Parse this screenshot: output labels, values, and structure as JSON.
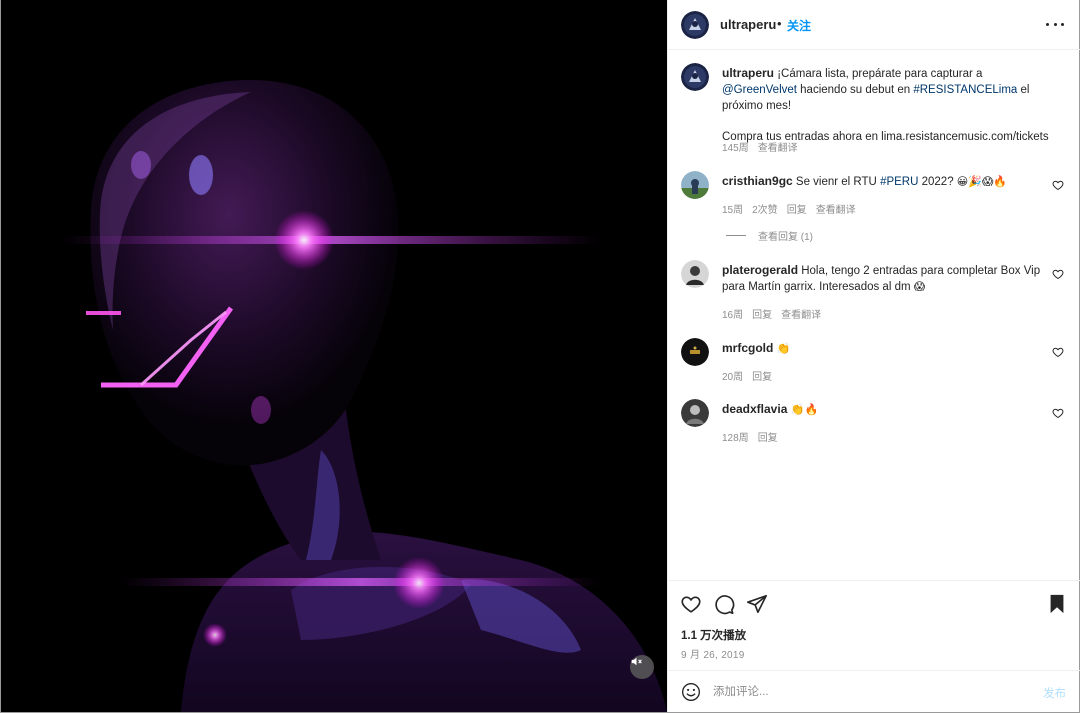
{
  "post": {
    "username": "ultraperu",
    "separator": "•",
    "follow_label": "关注",
    "caption_text": "¡Cámara lista, prepárate para capturar a ",
    "caption_mention": "@GreenVelvet",
    "caption_mid": " haciendo su debut en ",
    "caption_hashtag": "#RESISTANCELima",
    "caption_end": " el próximo mes!",
    "caption_line2": "Compra tus entradas ahora en lima.resistancemusic.com/tickets",
    "caption_time": "145周",
    "caption_translate": "查看翻译"
  },
  "comments": [
    {
      "username": "cristhian9gc",
      "text_before": " Se vienr el RTU ",
      "hashtag": "#PERU",
      "text_after": " 2022? ",
      "emoji": "😀🎉😱🔥",
      "time": "15周",
      "likes": "2次赞",
      "reply": "回复",
      "translate": "查看翻译",
      "view_replies": "查看回复 (1)"
    },
    {
      "username": "platerogerald",
      "text": " Hola, tengo 2 entradas para completar Box Vip para Martín garrix. Interesados al dm ",
      "emoji": "😱",
      "time": "16周",
      "reply": "回复",
      "translate": "查看翻译"
    },
    {
      "username": "mrfcgold",
      "emoji": " 👏",
      "time": "20周",
      "reply": "回复"
    },
    {
      "username": "deadxflavia",
      "emoji": " 👏🔥",
      "time": "128周",
      "reply": "回复"
    }
  ],
  "stats": {
    "views": "1.1 万次播放",
    "date": "9 月 26, 2019"
  },
  "add_comment": {
    "placeholder": "添加评论...",
    "post_label": "发布"
  },
  "icons": {
    "like": "heart-icon",
    "comment": "comment-icon",
    "share": "paper-plane-icon",
    "save": "bookmark-icon",
    "mute": "muted-speaker-icon",
    "emoji": "smiley-icon",
    "more": "more-options-icon"
  },
  "colors": {
    "link": "#00376b",
    "follow": "#0095f6",
    "secondary": "#8e8e8e",
    "post_disabled": "#b2dffc"
  }
}
